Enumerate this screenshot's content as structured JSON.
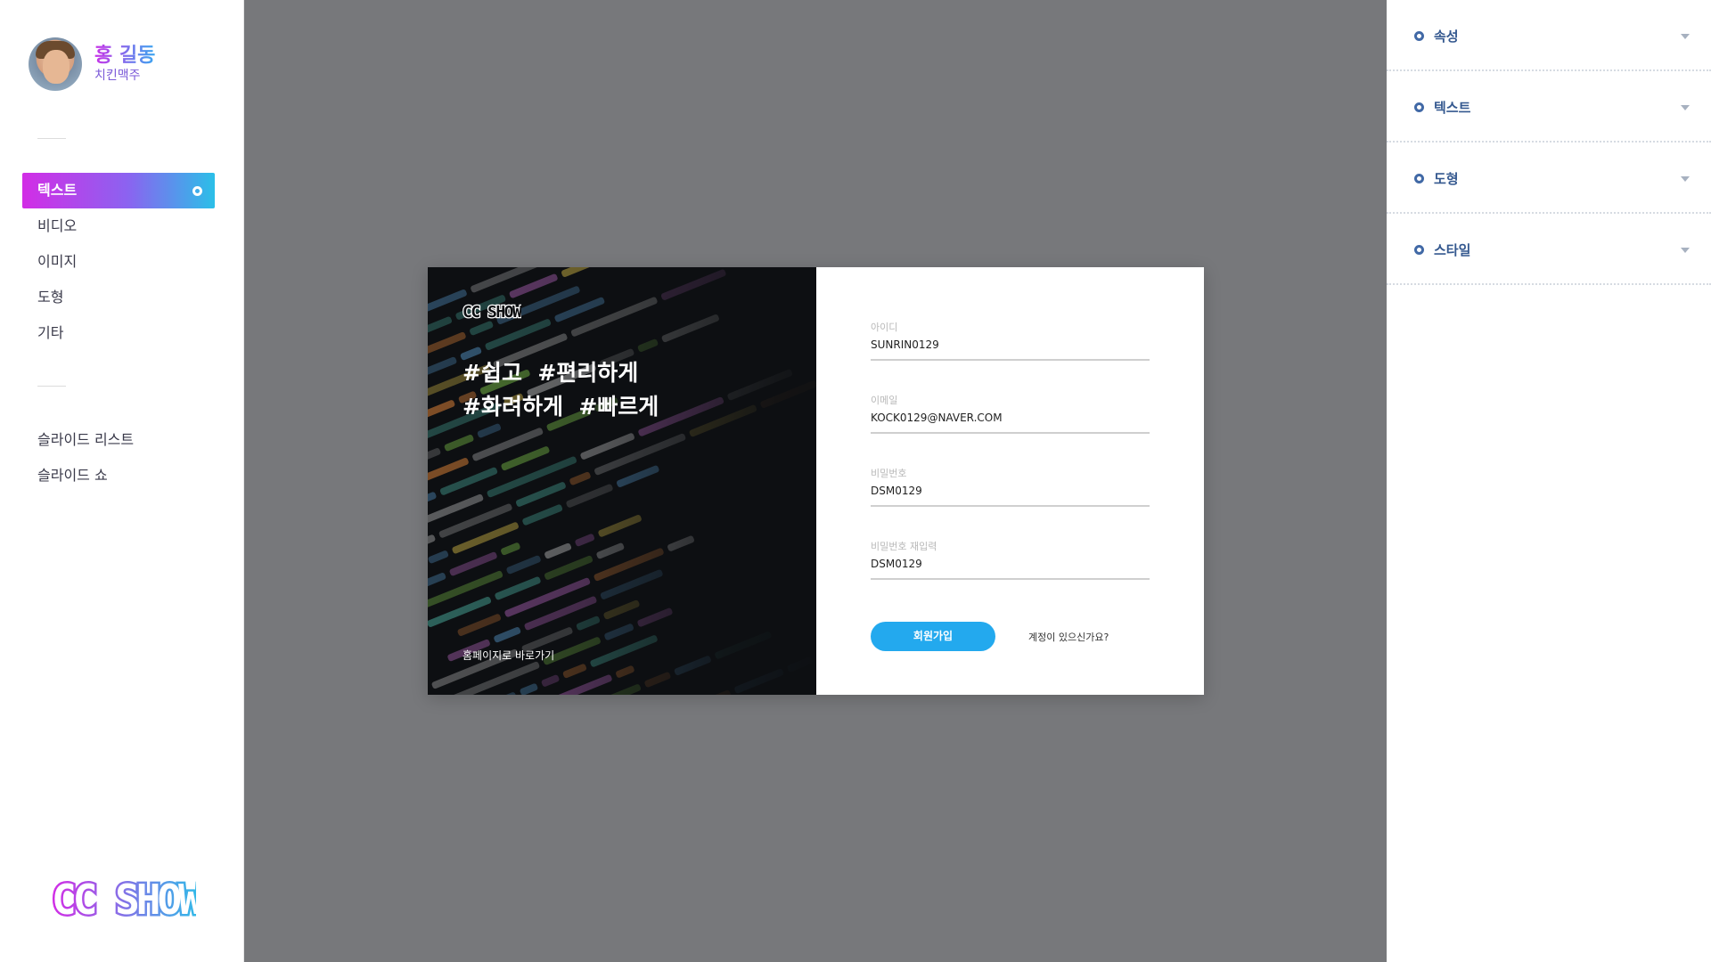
{
  "profile": {
    "name": "홍 길동",
    "subtitle": "치킨맥주"
  },
  "nav": {
    "items": [
      {
        "label": "텍스트",
        "active": true
      },
      {
        "label": "비디오",
        "active": false
      },
      {
        "label": "이미지",
        "active": false
      },
      {
        "label": "도형",
        "active": false
      },
      {
        "label": "기타",
        "active": false
      }
    ],
    "slides": [
      {
        "label": "슬라이드 리스트"
      },
      {
        "label": "슬라이드 쇼"
      }
    ]
  },
  "brand": {
    "logo_text": "CC SHOW"
  },
  "properties": {
    "sections": [
      {
        "label": "속성"
      },
      {
        "label": "텍스트"
      },
      {
        "label": "도형"
      },
      {
        "label": "스타일"
      }
    ]
  },
  "modal": {
    "logo_text": "CC SHOW",
    "headline_line1": "#쉽고  #편리하게",
    "headline_line2": "#화려하게  #빠르게",
    "home_link": "홈페이지로 바로가기",
    "fields": [
      {
        "label": "아이디",
        "value": "SUNRIN0129"
      },
      {
        "label": "이메일",
        "value": "KOCK0129@NAVER.COM"
      },
      {
        "label": "비밀번호",
        "value": "DSM0129"
      },
      {
        "label": "비밀번호 재입력",
        "value": "DSM0129"
      }
    ],
    "signup_label": "회원가입",
    "login_link": "계정이 있으신가요?"
  },
  "colors": {
    "canvas_bg": "#77787b",
    "accent_gradient_start": "#d22de6",
    "accent_gradient_end": "#2bbfe8",
    "button_blue": "#23a9ee",
    "prop_label": "#34588f"
  }
}
